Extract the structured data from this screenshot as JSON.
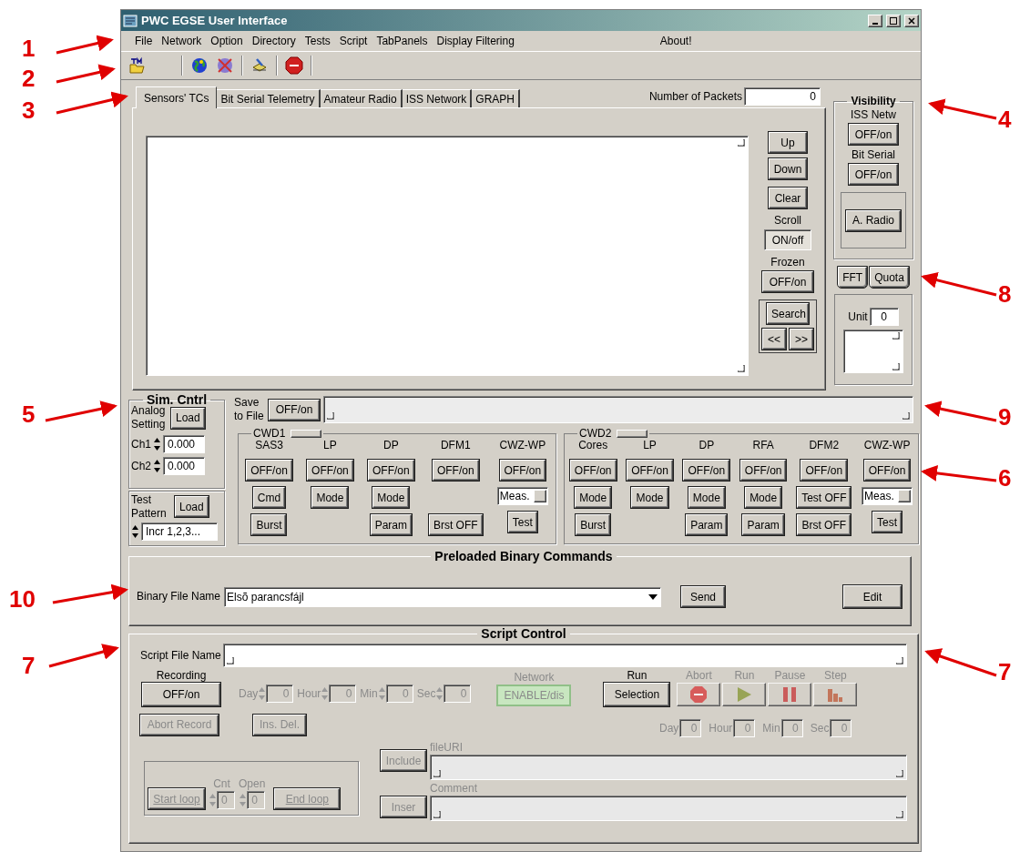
{
  "window": {
    "title": "PWC EGSE User Interface"
  },
  "menu": [
    "File",
    "Network",
    "Option",
    "Directory",
    "Tests",
    "Script",
    "TabPanels",
    "Display Filtering"
  ],
  "menu_about": "About!",
  "tabs": [
    {
      "label": "Sensors' TCs",
      "selected": true
    },
    {
      "label": "Bit Serial Telemetry",
      "selected": false
    },
    {
      "label": "Amateur Radio",
      "selected": false
    },
    {
      "label": "ISS Network",
      "selected": false
    },
    {
      "label": "GRAPH",
      "selected": false
    }
  ],
  "packets": {
    "label": "Number of Packets",
    "value": "0"
  },
  "list_controls": {
    "up": "Up",
    "down": "Down",
    "clear": "Clear",
    "scroll_label": "Scroll",
    "scroll_button": "ON/off",
    "scroll_pressed": true,
    "frozen_label": "Frozen",
    "frozen_button": "OFF/on",
    "frozen_pressed": false,
    "search": "Search",
    "prev": "<<",
    "next": ">>"
  },
  "visibility": {
    "title": "Visibility",
    "items": [
      {
        "label": "ISS Netw",
        "button": "OFF/on"
      },
      {
        "label": "Bit Serial",
        "button": "OFF/on"
      }
    ],
    "radio_button": "A. Radio"
  },
  "side_buttons": [
    "FFT",
    "Quota"
  ],
  "unit": {
    "label": "Unit",
    "value": "0"
  },
  "sim": {
    "title": "Sim. Cntrl",
    "analog_label": "Analog Setting",
    "analog_load": "Load",
    "channels": [
      {
        "label": "Ch1",
        "value": "0.000"
      },
      {
        "label": "Ch2",
        "value": "0.000"
      }
    ],
    "test_label": "Test Pattern",
    "test_load": "Load",
    "pattern": "Incr 1,2,3..."
  },
  "save": {
    "label": "Save to File",
    "button": "OFF/on"
  },
  "cwd_groups": [
    {
      "title": "CWD1",
      "columns": [
        {
          "name": "SAS3",
          "top": {
            "kind": "button",
            "label": "OFF/on"
          },
          "middle": {
            "kind": "button",
            "label": "Cmd"
          },
          "bottom": {
            "kind": "button",
            "label": "Burst"
          }
        },
        {
          "name": "LP",
          "top": {
            "kind": "button",
            "label": "OFF/on"
          },
          "middle": {
            "kind": "button",
            "label": "Mode"
          }
        },
        {
          "name": "DP",
          "top": {
            "kind": "button",
            "label": "OFF/on"
          },
          "middle": {
            "kind": "button",
            "label": "Mode"
          },
          "bottom": {
            "kind": "button",
            "label": "Param"
          }
        },
        {
          "name": "DFM1",
          "top": {
            "kind": "button",
            "label": "OFF/on"
          },
          "bottom": {
            "kind": "button",
            "label": "Brst OFF"
          }
        },
        {
          "name": "CWZ-WP",
          "top": {
            "kind": "button",
            "label": "OFF/on"
          },
          "middle": {
            "kind": "field",
            "value": "Meas."
          },
          "bottom": {
            "kind": "button",
            "label": "Test"
          }
        }
      ]
    },
    {
      "title": "CWD2",
      "columns": [
        {
          "name": "Cores",
          "top": {
            "kind": "button",
            "label": "OFF/on"
          },
          "middle": {
            "kind": "button",
            "label": "Mode"
          },
          "bottom": {
            "kind": "button",
            "label": "Burst"
          }
        },
        {
          "name": "LP",
          "top": {
            "kind": "button",
            "label": "OFF/on"
          },
          "middle": {
            "kind": "button",
            "label": "Mode"
          }
        },
        {
          "name": "DP",
          "top": {
            "kind": "button",
            "label": "OFF/on"
          },
          "middle": {
            "kind": "button",
            "label": "Mode"
          },
          "bottom": {
            "kind": "button",
            "label": "Param"
          }
        },
        {
          "name": "RFA",
          "top": {
            "kind": "button",
            "label": "OFF/on"
          },
          "middle": {
            "kind": "button",
            "label": "Mode"
          },
          "bottom": {
            "kind": "button",
            "label": "Param"
          }
        },
        {
          "name": "DFM2",
          "top": {
            "kind": "button",
            "label": "OFF/on"
          },
          "middle": {
            "kind": "button",
            "label": "Test OFF"
          },
          "bottom": {
            "kind": "button",
            "label": "Brst OFF"
          }
        },
        {
          "name": "CWZ-WP",
          "top": {
            "kind": "button",
            "label": "OFF/on"
          },
          "middle": {
            "kind": "field",
            "value": "Meas."
          },
          "bottom": {
            "kind": "button",
            "label": "Test"
          }
        }
      ]
    }
  ],
  "binary": {
    "title": "Preloaded Binary Commands",
    "label": "Binary File Name",
    "value": "Elsõ parancsfájl",
    "send": "Send",
    "edit": "Edit"
  },
  "script": {
    "title": "Script Control",
    "file_label": "Script File Name",
    "recording_label": "Recording",
    "recording_button": "OFF/on",
    "timers": [
      {
        "label": "Day",
        "value": "0",
        "disabled": true
      },
      {
        "label": "Hour",
        "value": "0",
        "disabled": true
      },
      {
        "label": "Min",
        "value": "0",
        "disabled": true
      },
      {
        "label": "Sec",
        "value": "0",
        "disabled": true
      }
    ],
    "network": {
      "label": "Network",
      "button": "ENABLE/dis",
      "disabled": true
    },
    "run": {
      "label": "Run",
      "button": "Selection"
    },
    "controls": [
      {
        "label": "Abort",
        "kind": "stop",
        "disabled": true
      },
      {
        "label": "Run",
        "kind": "play",
        "disabled": true
      },
      {
        "label": "Pause",
        "kind": "pause",
        "disabled": true
      },
      {
        "label": "Step",
        "kind": "step",
        "disabled": true
      }
    ],
    "abort_record": {
      "label": "Abort Record",
      "disabled": true
    },
    "ins_del": {
      "label": "Ins. Del.",
      "disabled": true
    },
    "timers2": [
      {
        "label": "Day",
        "value": "0",
        "disabled": true
      },
      {
        "label": "Hour",
        "value": "0",
        "disabled": true
      },
      {
        "label": "Min",
        "value": "0",
        "disabled": true
      },
      {
        "label": "Sec",
        "value": "0",
        "disabled": true
      }
    ],
    "loop": {
      "start": "Start loop",
      "cnt_label": "Cnt",
      "cnt": "0",
      "open_label": "Open",
      "open": "0",
      "end": "End loop",
      "disabled": true
    },
    "include": {
      "label": "Include",
      "disabled": true
    },
    "uri_label": "fileURI",
    "insert": {
      "label": "Inser",
      "disabled": true
    },
    "comment_label": "Comment"
  },
  "annotations": [
    "1",
    "2",
    "3",
    "4",
    "8",
    "5",
    "9",
    "6",
    "10",
    "7",
    "7"
  ]
}
